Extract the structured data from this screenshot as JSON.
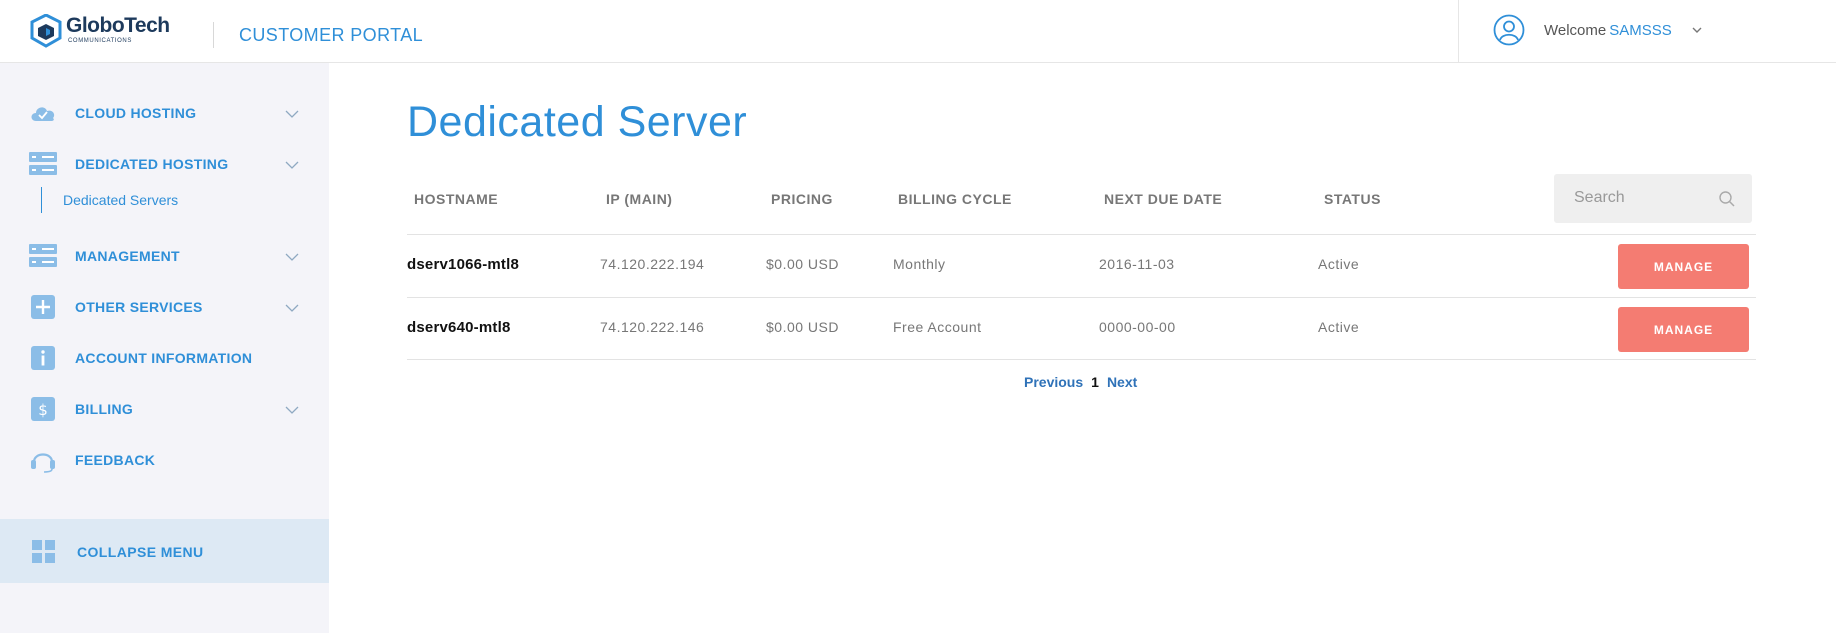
{
  "header": {
    "logo_name": "GloboTech",
    "logo_sub": "COMMUNICATIONS",
    "portal_title": "CUSTOMER PORTAL",
    "welcome_label": "Welcome",
    "username": "SAMSSS"
  },
  "sidebar": {
    "items": [
      {
        "label": "CLOUD HOSTING",
        "icon": "cloud-icon",
        "has_chevron": true
      },
      {
        "label": "DEDICATED HOSTING",
        "icon": "server-icon",
        "has_chevron": true
      },
      {
        "label": "MANAGEMENT",
        "icon": "server-icon",
        "has_chevron": true
      },
      {
        "label": "OTHER SERVICES",
        "icon": "plus-icon",
        "has_chevron": true
      },
      {
        "label": "ACCOUNT INFORMATION",
        "icon": "info-icon",
        "has_chevron": false
      },
      {
        "label": "BILLING",
        "icon": "dollar-icon",
        "has_chevron": true
      },
      {
        "label": "FEEDBACK",
        "icon": "headset-icon",
        "has_chevron": false
      }
    ],
    "subitem": "Dedicated Servers",
    "collapse_label": "COLLAPSE MENU"
  },
  "main": {
    "title": "Dedicated Server",
    "columns": [
      "HOSTNAME",
      "IP (MAIN)",
      "PRICING",
      "BILLING CYCLE",
      "NEXT DUE DATE",
      "STATUS"
    ],
    "search_placeholder": "Search",
    "rows": [
      {
        "hostname": "dserv1066-mtl8",
        "ip": "74.120.222.194",
        "pricing": "$0.00 USD",
        "cycle": "Monthly",
        "due": "2016-11-03",
        "status": "Active",
        "action": "MANAGE"
      },
      {
        "hostname": "dserv640-mtl8",
        "ip": "74.120.222.146",
        "pricing": "$0.00 USD",
        "cycle": "Free Account",
        "due": "0000-00-00",
        "status": "Active",
        "action": "MANAGE"
      }
    ],
    "pagination": {
      "prev": "Previous",
      "current": "1",
      "next": "Next"
    }
  },
  "colors": {
    "accent": "#2f8fd8",
    "manage_button": "#f47c72",
    "sidebar_bg": "#f4f4f9",
    "collapse_bg": "#dde9f4"
  }
}
